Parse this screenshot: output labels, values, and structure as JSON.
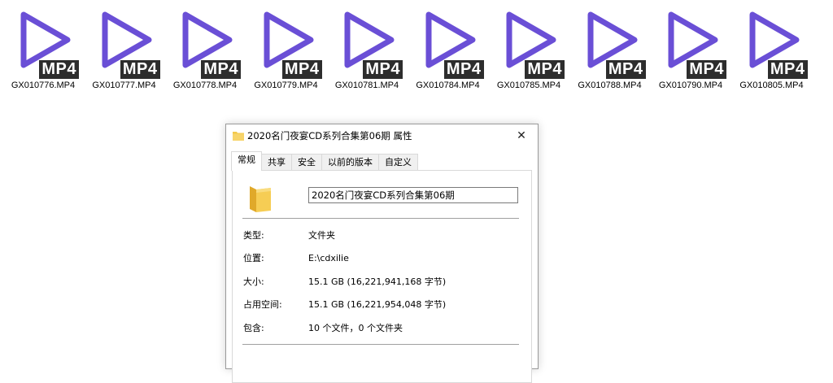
{
  "files": [
    {
      "name": "GX010776.MP4",
      "badge": "MP4",
      "icon": "play-icon"
    },
    {
      "name": "GX010777.MP4",
      "badge": "MP4",
      "icon": "play-icon"
    },
    {
      "name": "GX010778.MP4",
      "badge": "MP4",
      "icon": "play-icon"
    },
    {
      "name": "GX010779.MP4",
      "badge": "MP4",
      "icon": "play-icon"
    },
    {
      "name": "GX010781.MP4",
      "badge": "MP4",
      "icon": "play-icon"
    },
    {
      "name": "GX010784.MP4",
      "badge": "MP4",
      "icon": "play-icon"
    },
    {
      "name": "GX010785.MP4",
      "badge": "MP4",
      "icon": "play-icon"
    },
    {
      "name": "GX010788.MP4",
      "badge": "MP4",
      "icon": "play-icon"
    },
    {
      "name": "GX010790.MP4",
      "badge": "MP4",
      "icon": "play-icon"
    },
    {
      "name": "GX010805.MP4",
      "badge": "MP4",
      "icon": "play-icon"
    }
  ],
  "colors": {
    "play_icon": "#6a4fd6",
    "badge_bg": "#2d2d2d",
    "folder": "#f3c94b"
  },
  "dialog": {
    "title": "2020名门夜宴CD系列合集第06期 属性",
    "close": "✕",
    "tabs": [
      {
        "label": "常规",
        "active": true
      },
      {
        "label": "共享",
        "active": false
      },
      {
        "label": "安全",
        "active": false
      },
      {
        "label": "以前的版本",
        "active": false
      },
      {
        "label": "自定义",
        "active": false
      }
    ],
    "name_value": "2020名门夜宴CD系列合集第06期",
    "properties": [
      {
        "label": "类型:",
        "value": "文件夹"
      },
      {
        "label": "位置:",
        "value": "E:\\cdxilie"
      },
      {
        "label": "大小:",
        "value": "15.1 GB (16,221,941,168 字节)"
      },
      {
        "label": "占用空间:",
        "value": "15.1 GB (16,221,954,048 字节)"
      },
      {
        "label": "包含:",
        "value": "10 个文件，0 个文件夹"
      }
    ]
  }
}
